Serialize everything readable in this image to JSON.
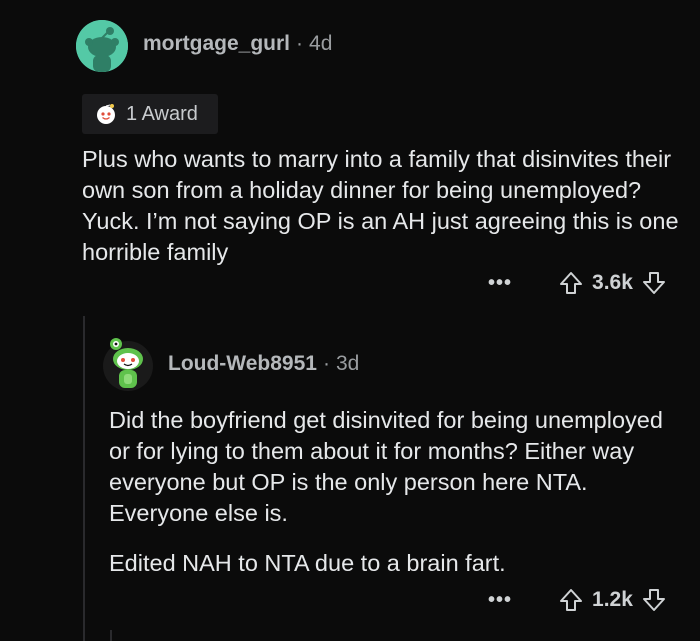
{
  "comment1": {
    "username": "mortgage_gurl",
    "age": "4d",
    "award_label": "1 Award",
    "text": "Plus who wants to marry into a family that disinvites their own son from a holiday dinner for being unemployed?  Yuck.  I’m not saying OP is an AH just agreeing this is one horrible family",
    "more": "•••",
    "votes": "3.6k"
  },
  "comment2": {
    "username": "Loud-Web8951",
    "age": "3d",
    "text": "Did the boyfriend get disinvited for being unemployed or for lying to them about it for months? Either way everyone but OP is the only person here NTA. Everyone else is.",
    "edit_note": "Edited NAH to NTA due to a brain fart.",
    "more": "•••",
    "votes": "1.2k"
  },
  "separator": "·",
  "colors": {
    "background": "#0b0b0b",
    "avatar1": "#54c9a6",
    "text": "#e6e8ea",
    "meta": "#9a9da0"
  }
}
